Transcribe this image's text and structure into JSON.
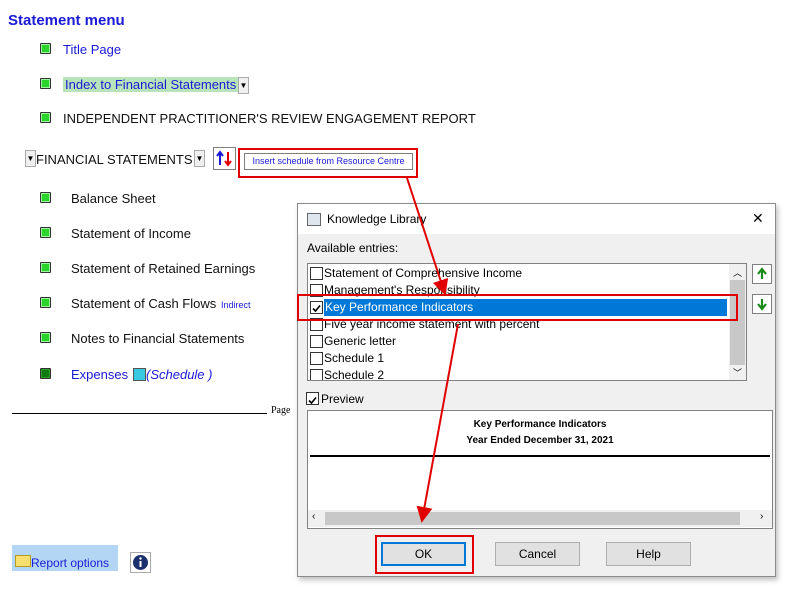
{
  "menu": {
    "title": "Statement menu",
    "title_page": "Title Page",
    "index": "Index to Financial Statements",
    "independent_report": "INDEPENDENT PRACTITIONER'S REVIEW ENGAGEMENT REPORT",
    "financial_statements": "FINANCIAL STATEMENTS",
    "insert_schedule": "Insert schedule from Resource Centre",
    "balance_sheet": "Balance Sheet",
    "statement_income": "Statement of Income",
    "retained_earnings": "Statement of Retained Earnings",
    "cash_flows": "Statement of Cash Flows",
    "cash_flows_method": "Indirect",
    "notes": "Notes to Financial Statements",
    "expenses": "Expenses",
    "schedule_tag": "(Schedule )",
    "page_label": "Page",
    "report_options": "Report options"
  },
  "dialog": {
    "title": "Knowledge Library",
    "close": "✕",
    "available_label": "Available entries:",
    "entries": [
      {
        "label": "Statement of Comprehensive Income",
        "checked": false,
        "selected": false
      },
      {
        "label": "Management's Responsibility",
        "checked": false,
        "selected": false
      },
      {
        "label": "Key Performance Indicators",
        "checked": true,
        "selected": true
      },
      {
        "label": "Five year income statement with percent",
        "checked": false,
        "selected": false
      },
      {
        "label": "Generic letter",
        "checked": false,
        "selected": false
      },
      {
        "label": "Schedule 1",
        "checked": false,
        "selected": false
      },
      {
        "label": "Schedule 2",
        "checked": false,
        "selected": false
      }
    ],
    "preview_label": "Preview",
    "preview_checked": true,
    "preview_title": "Key Performance Indicators",
    "preview_subtitle": "Year Ended December 31, 2021",
    "ok": "OK",
    "cancel": "Cancel",
    "help": "Help"
  },
  "colors": {
    "link": "#1a1ad6",
    "highlight_red": "#e10000",
    "selection_blue": "#0078d7",
    "status_green": "#2bd42b"
  }
}
